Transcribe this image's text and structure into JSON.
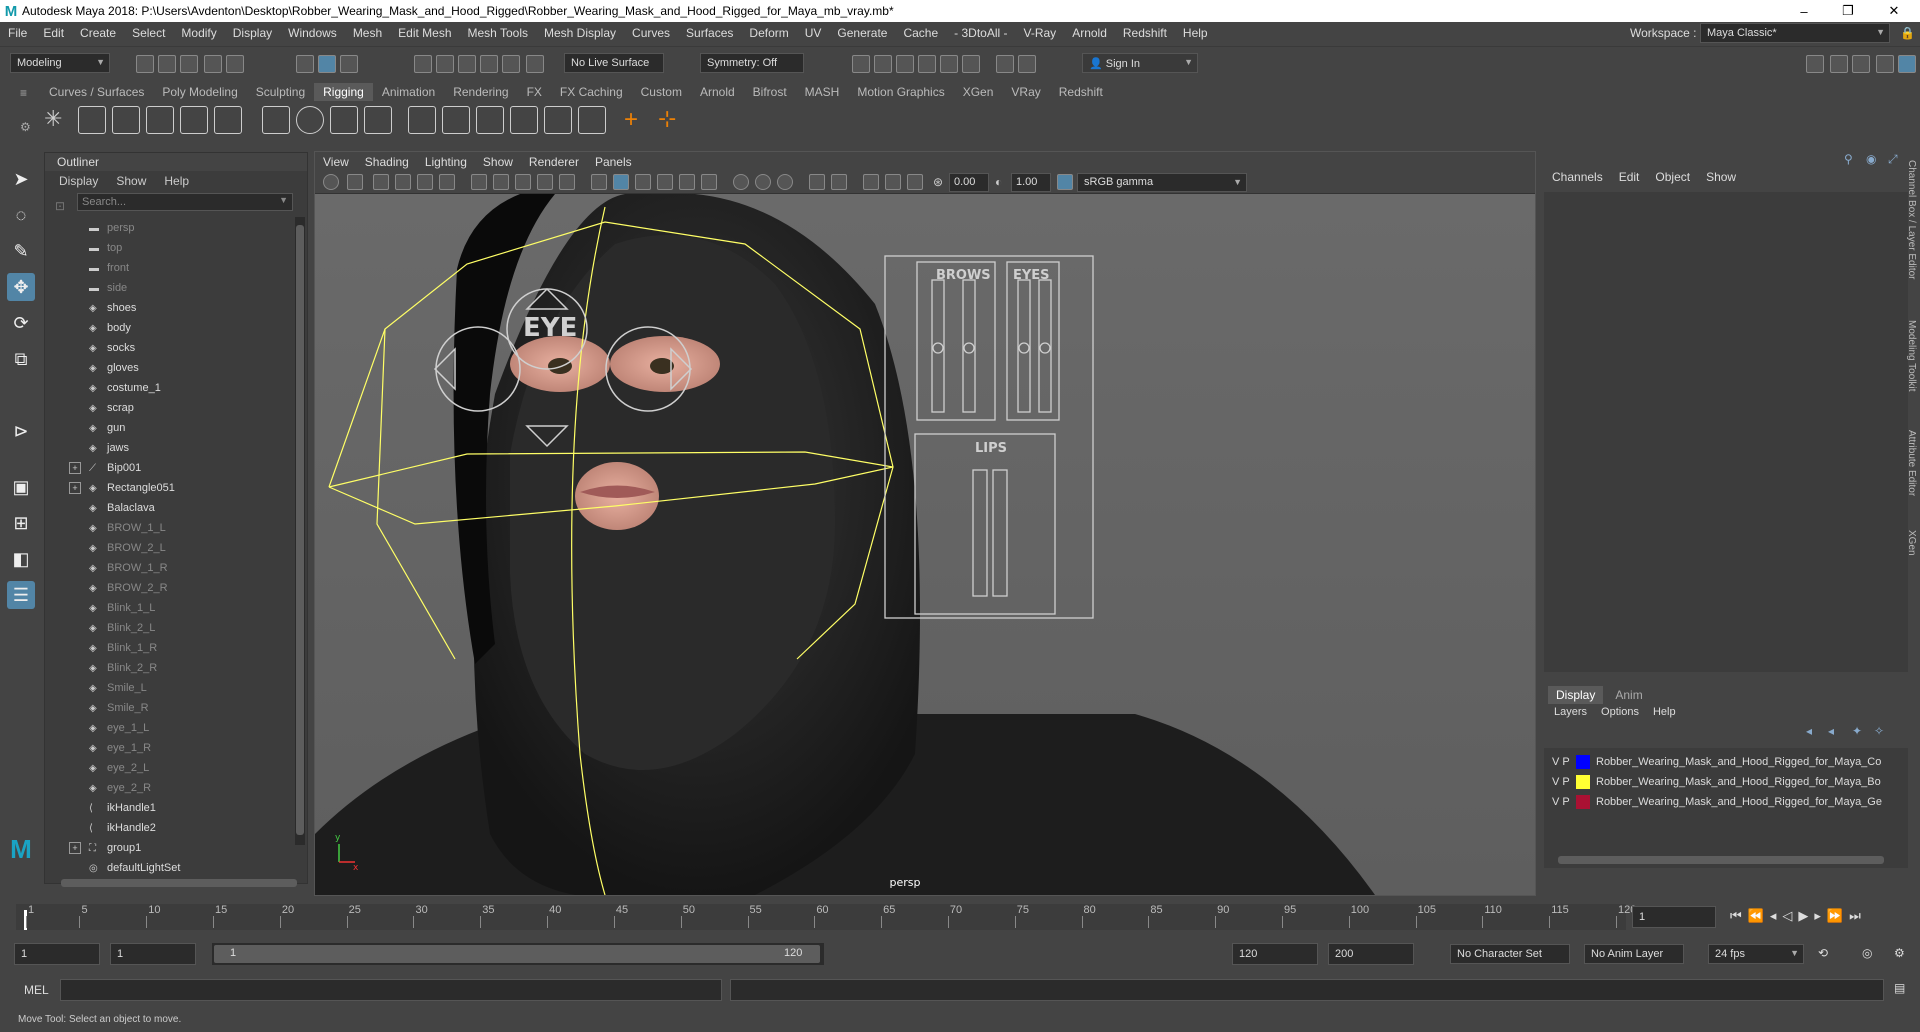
{
  "window": {
    "title": "Autodesk Maya 2018: P:\\Users\\Avdenton\\Desktop\\Robber_Wearing_Mask_and_Hood_Rigged\\Robber_Wearing_Mask_and_Hood_Rigged_for_Maya_mb_vray.mb*",
    "logo": "M",
    "minimize": "–",
    "maximize": "❐",
    "close": "✕"
  },
  "menubar": [
    "File",
    "Edit",
    "Create",
    "Select",
    "Modify",
    "Display",
    "Windows",
    "Mesh",
    "Edit Mesh",
    "Mesh Tools",
    "Mesh Display",
    "Curves",
    "Surfaces",
    "Deform",
    "UV",
    "Generate",
    "Cache",
    "- 3DtoAll -",
    "V-Ray",
    "Arnold",
    "Redshift",
    "Help"
  ],
  "workspace": {
    "label": "Workspace :",
    "value": "Maya Classic*"
  },
  "statusline": {
    "mode": "Modeling",
    "live_surface": "No Live Surface",
    "symmetry": "Symmetry: Off",
    "sign_in": "Sign In"
  },
  "shelf_tabs": [
    "Curves / Surfaces",
    "Poly Modeling",
    "Sculpting",
    "Rigging",
    "Animation",
    "Rendering",
    "FX",
    "FX Caching",
    "Custom",
    "Arnold",
    "Bifrost",
    "MASH",
    "Motion Graphics",
    "XGen",
    "VRay",
    "Redshift"
  ],
  "shelf_active": "Rigging",
  "outliner": {
    "title": "Outliner",
    "menu": [
      "Display",
      "Show",
      "Help"
    ],
    "search_placeholder": "Search...",
    "items": [
      {
        "label": "persp",
        "dim": true,
        "icon": "camera"
      },
      {
        "label": "top",
        "dim": true,
        "icon": "camera"
      },
      {
        "label": "front",
        "dim": true,
        "icon": "camera"
      },
      {
        "label": "side",
        "dim": true,
        "icon": "camera"
      },
      {
        "label": "shoes",
        "dim": false,
        "icon": "mesh"
      },
      {
        "label": "body",
        "dim": false,
        "icon": "mesh"
      },
      {
        "label": "socks",
        "dim": false,
        "icon": "mesh"
      },
      {
        "label": "gloves",
        "dim": false,
        "icon": "mesh"
      },
      {
        "label": "costume_1",
        "dim": false,
        "icon": "mesh"
      },
      {
        "label": "scrap",
        "dim": false,
        "icon": "mesh"
      },
      {
        "label": "gun",
        "dim": false,
        "icon": "mesh"
      },
      {
        "label": "jaws",
        "dim": false,
        "icon": "mesh"
      },
      {
        "label": "Bip001",
        "dim": false,
        "icon": "joint",
        "expand": true
      },
      {
        "label": "Rectangle051",
        "dim": false,
        "icon": "mesh",
        "expand": true
      },
      {
        "label": "Balaclava",
        "dim": false,
        "icon": "mesh"
      },
      {
        "label": "BROW_1_L",
        "dim": true,
        "icon": "mesh"
      },
      {
        "label": "BROW_2_L",
        "dim": true,
        "icon": "mesh"
      },
      {
        "label": "BROW_1_R",
        "dim": true,
        "icon": "mesh"
      },
      {
        "label": "BROW_2_R",
        "dim": true,
        "icon": "mesh"
      },
      {
        "label": "Blink_1_L",
        "dim": true,
        "icon": "mesh"
      },
      {
        "label": "Blink_2_L",
        "dim": true,
        "icon": "mesh"
      },
      {
        "label": "Blink_1_R",
        "dim": true,
        "icon": "mesh"
      },
      {
        "label": "Blink_2_R",
        "dim": true,
        "icon": "mesh"
      },
      {
        "label": "Smile_L",
        "dim": true,
        "icon": "mesh"
      },
      {
        "label": "Smile_R",
        "dim": true,
        "icon": "mesh"
      },
      {
        "label": "eye_1_L",
        "dim": true,
        "icon": "mesh"
      },
      {
        "label": "eye_1_R",
        "dim": true,
        "icon": "mesh"
      },
      {
        "label": "eye_2_L",
        "dim": true,
        "icon": "mesh"
      },
      {
        "label": "eye_2_R",
        "dim": true,
        "icon": "mesh"
      },
      {
        "label": "ikHandle1",
        "dim": false,
        "icon": "ik"
      },
      {
        "label": "ikHandle2",
        "dim": false,
        "icon": "ik"
      },
      {
        "label": "group1",
        "dim": false,
        "icon": "group",
        "expand": true
      },
      {
        "label": "defaultLightSet",
        "dim": false,
        "icon": "set"
      }
    ]
  },
  "viewport": {
    "menu": [
      "View",
      "Shading",
      "Lighting",
      "Show",
      "Renderer",
      "Panels"
    ],
    "exposure": "0.00",
    "gamma": "1.00",
    "color_space": "sRGB gamma",
    "camera_label": "persp",
    "ctrl_eye": "EYE",
    "ctrl_brows": "BROWS",
    "ctrl_eyes": "EYES",
    "ctrl_lips": "LIPS",
    "axis_x": "x",
    "axis_y": "y"
  },
  "channelbox": {
    "menu": [
      "Channels",
      "Edit",
      "Object",
      "Show"
    ],
    "side_tabs": [
      "Channel Box / Layer Editor",
      "Modeling Toolkit",
      "Attribute Editor",
      "XGen"
    ]
  },
  "layer_editor": {
    "tabs": [
      "Display",
      "Anim"
    ],
    "menu": [
      "Layers",
      "Options",
      "Help"
    ],
    "layers": [
      {
        "v": "V",
        "p": "P",
        "color": "#0000ff",
        "name": "Robber_Wearing_Mask_and_Hood_Rigged_for_Maya_Co"
      },
      {
        "v": "V",
        "p": "P",
        "color": "#ffff33",
        "name": "Robber_Wearing_Mask_and_Hood_Rigged_for_Maya_Bo"
      },
      {
        "v": "V",
        "p": "P",
        "color": "#aa1133",
        "name": "Robber_Wearing_Mask_and_Hood_Rigged_for_Maya_Ge"
      }
    ]
  },
  "timeslider": {
    "ticks": [
      "1",
      "5",
      "10",
      "15",
      "20",
      "25",
      "30",
      "35",
      "40",
      "45",
      "50",
      "55",
      "60",
      "65",
      "70",
      "75",
      "80",
      "85",
      "90",
      "95",
      "100",
      "105",
      "110",
      "115",
      "120"
    ],
    "current_frame": "1"
  },
  "range": {
    "start": "1",
    "anim_start": "1",
    "range_start": "1",
    "range_end": "120",
    "end": "120",
    "anim_end": "200",
    "character_set": "No Character Set",
    "anim_layer": "No Anim Layer",
    "fps": "24 fps"
  },
  "cmdline": {
    "label": "MEL"
  },
  "helpline": "Move Tool: Select an object to move."
}
